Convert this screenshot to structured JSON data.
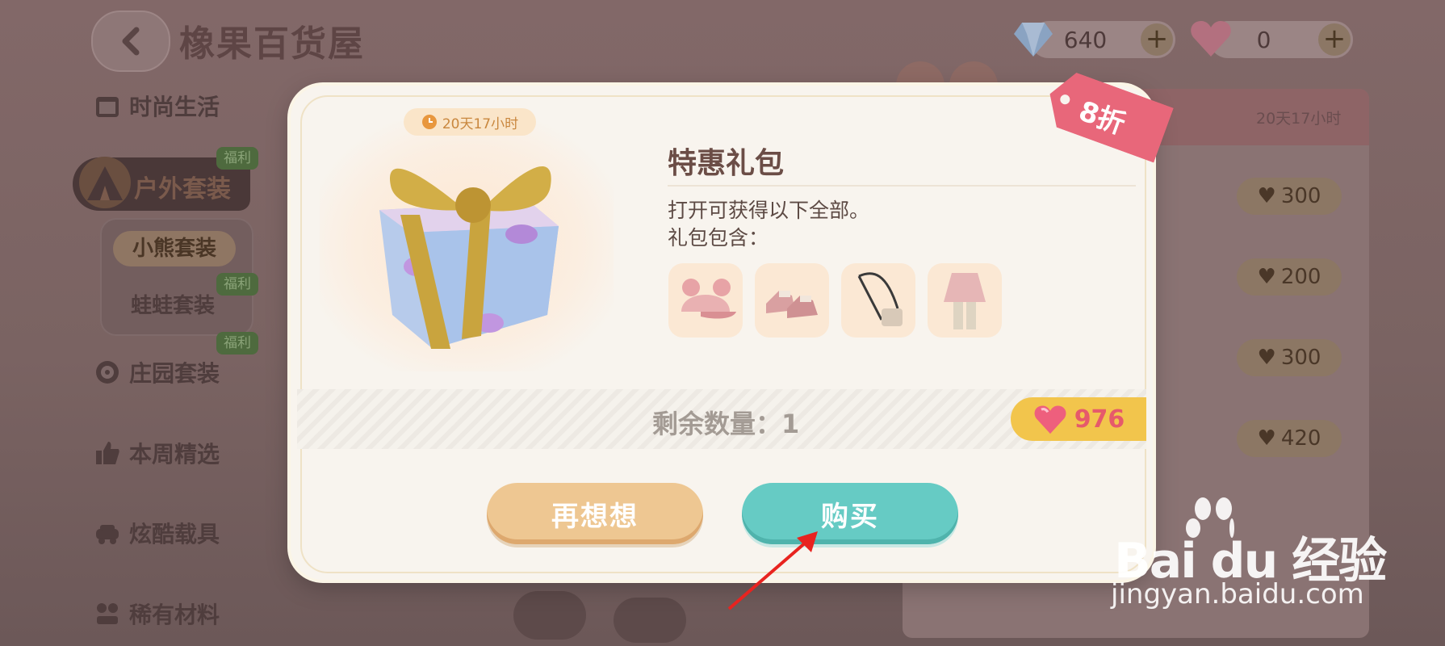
{
  "header": {
    "title": "橡果百货屋",
    "currencies": [
      {
        "name": "blue-diamond",
        "value": "640"
      },
      {
        "name": "pink-heart",
        "value": "0"
      }
    ]
  },
  "sidebar": {
    "items": [
      {
        "label": "时尚生活",
        "icon": "calendar-icon"
      },
      {
        "label": "户外套装",
        "icon": "tent-icon",
        "badge": "福利",
        "active": true
      },
      {
        "label": "庄园套装",
        "icon": "rose-icon",
        "badge": "福利"
      },
      {
        "label": "本周精选",
        "icon": "thumbs-up-icon"
      },
      {
        "label": "炫酷载具",
        "icon": "car-icon"
      },
      {
        "label": "稀有材料",
        "icon": "materials-icon"
      }
    ],
    "sub_items": [
      {
        "label": "小熊套装",
        "selected": true
      },
      {
        "label": "蛙蛙套装",
        "badge": "福利"
      }
    ]
  },
  "right_list": {
    "timer": "20天17小时",
    "prices": [
      "300",
      "200",
      "300",
      "420"
    ]
  },
  "modal": {
    "timer": "20天17小时",
    "discount": "8折",
    "title": "特惠礼包",
    "desc_line1": "打开可获得以下全部。",
    "desc_line2": "礼包包含：",
    "items": [
      "bear-ear-cap",
      "pink-sneakers",
      "crossbody-bag",
      "pink-jacket-outfit"
    ],
    "remaining": "剩余数量：1",
    "price": "976",
    "cancel_label": "再想想",
    "buy_label": "购买"
  },
  "watermark": {
    "brand": "Bai du 经验",
    "url": "jingyan.baidu.com"
  },
  "colors": {
    "buy_button": "#66cbc4",
    "cancel_button": "#eec792",
    "discount_tag": "#e8677a",
    "price_tag": "#f2c54c"
  }
}
